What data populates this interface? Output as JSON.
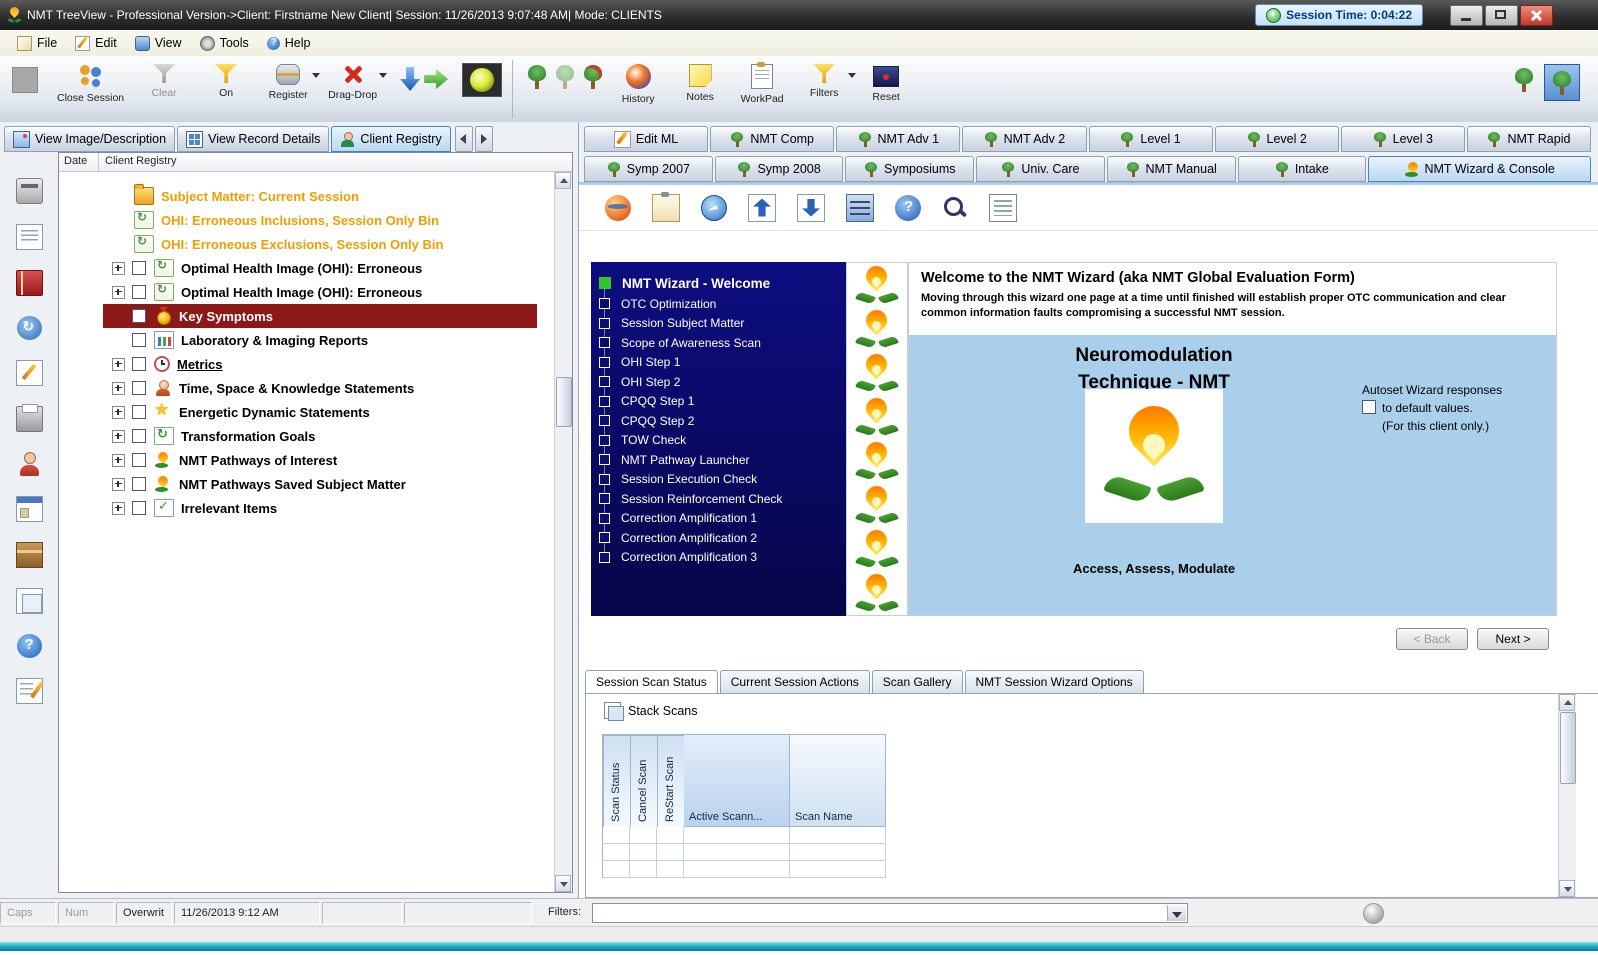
{
  "titlebar": {
    "title": "NMT TreeView - Professional Version->Client: Firstname New Client| Session: 11/26/2013 9:07:48 AM| Mode: CLIENTS",
    "session_time": "Session Time: 0:04:22"
  },
  "menubar": {
    "items": [
      {
        "label": "File",
        "icon": "file"
      },
      {
        "label": "Edit",
        "icon": "editpage"
      },
      {
        "label": "View",
        "icon": "view"
      },
      {
        "label": "Tools",
        "icon": "tools"
      },
      {
        "label": "Help",
        "icon": "helpmini"
      }
    ]
  },
  "toolbar": {
    "close_session": "Close Session",
    "clear": "Clear",
    "on": "On",
    "register": "Register",
    "drag_drop": "Drag-Drop",
    "history": "History",
    "notes": "Notes",
    "workpad": "WorkPad",
    "filters": "Filters",
    "reset": "Reset"
  },
  "left_tabs": {
    "items": [
      {
        "label": "View Image/Description",
        "icon": "image"
      },
      {
        "label": "View Record Details",
        "icon": "grid"
      },
      {
        "label": "Client Registry",
        "icon": "clientreg",
        "active": true
      }
    ]
  },
  "tree": {
    "columns": [
      "Date",
      "Client Registry"
    ],
    "items": [
      {
        "label": "Subject Matter: Current Session",
        "cls": "orange",
        "icon": "folderop"
      },
      {
        "label": "OHI: Erroneous Inclusions, Session Only Bin",
        "cls": "orange",
        "icon": "scroll"
      },
      {
        "label": "OHI: Erroneous Exclusions, Session Only Bin",
        "cls": "orange",
        "icon": "scroll"
      },
      {
        "label": "Optimal Health Image (OHI): Erroneous",
        "icon": "scroll",
        "expand": true,
        "check": true
      },
      {
        "label": "Optimal Health Image (OHI): Erroneous",
        "icon": "scroll",
        "expand": true,
        "check": true
      },
      {
        "label": "Key Symptoms",
        "cls": "selected",
        "icon": "trophy",
        "check": true
      },
      {
        "label": "Laboratory & Imaging Reports",
        "icon": "chart",
        "check": true
      },
      {
        "label": "Metrics",
        "cls": "underline",
        "icon": "clock",
        "expand": true,
        "check": true
      },
      {
        "label": "Time, Space & Knowledge Statements",
        "icon": "person",
        "expand": true,
        "check": true
      },
      {
        "label": "Energetic Dynamic Statements",
        "icon": "star",
        "expand": true,
        "check": true
      },
      {
        "label": "Transformation Goals",
        "icon": "recycle",
        "expand": true,
        "check": true
      },
      {
        "label": "NMT Pathways of Interest",
        "icon": "flame",
        "expand": true,
        "check": true
      },
      {
        "label": "NMT Pathways Saved Subject Matter",
        "icon": "flame",
        "expand": true,
        "check": true
      },
      {
        "label": "Irrelevant Items",
        "icon": "pagecheck",
        "expand": true,
        "check": true
      }
    ]
  },
  "right_tabs": {
    "row1": [
      {
        "label": "Edit ML",
        "icon": "pencil"
      },
      {
        "label": "NMT Comp",
        "icon": "tree"
      },
      {
        "label": "NMT Adv 1",
        "icon": "tree"
      },
      {
        "label": "NMT Adv 2",
        "icon": "tree"
      },
      {
        "label": "Level 1",
        "icon": "tree"
      },
      {
        "label": "Level 2",
        "icon": "tree"
      },
      {
        "label": "Level 3",
        "icon": "tree"
      },
      {
        "label": "NMT Rapid",
        "icon": "tree"
      }
    ],
    "row2": [
      {
        "label": "Symp 2007",
        "icon": "tree"
      },
      {
        "label": "Symp 2008",
        "icon": "tree"
      },
      {
        "label": "Symposiums",
        "icon": "tree"
      },
      {
        "label": "Univ. Care",
        "icon": "tree"
      },
      {
        "label": "NMT Manual",
        "icon": "tree"
      },
      {
        "label": "Intake",
        "icon": "tree"
      },
      {
        "label": "NMT Wizard & Console",
        "icon": "flame",
        "active": true
      }
    ]
  },
  "wizard": {
    "nav": [
      {
        "label": "NMT Wizard - Welcome",
        "current": true
      },
      {
        "label": "OTC Optimization"
      },
      {
        "label": "Session Subject Matter"
      },
      {
        "label": "Scope of Awareness Scan"
      },
      {
        "label": "OHI Step 1"
      },
      {
        "label": "OHI Step 2"
      },
      {
        "label": "CPQQ Step 1"
      },
      {
        "label": "CPQQ Step 2"
      },
      {
        "label": "TOW Check"
      },
      {
        "label": "NMT Pathway Launcher"
      },
      {
        "label": "Session Execution Check"
      },
      {
        "label": "Session Reinforcement Check"
      },
      {
        "label": "Correction Amplification 1"
      },
      {
        "label": "Correction Amplification 2"
      },
      {
        "label": "Correction Amplification 3"
      }
    ],
    "welcome_title": "Welcome to the NMT Wizard (aka NMT Global Evaluation Form)",
    "welcome_body": "Moving through this wizard one page at a time until finished will establish proper OTC communication and clear common information faults compromising a successful NMT session.",
    "brand_line1": "Neuromodulation",
    "brand_line2": "Technique - NMT",
    "autoset": {
      "line1": "Autoset Wizard responses",
      "line2": "to default values.",
      "line3": "(For this client only.)"
    },
    "tagline": "Access, Assess, Modulate",
    "back_label": "< Back",
    "next_label": "Next >"
  },
  "bottom_tabs": {
    "items": [
      {
        "label": "Session Scan Status",
        "active": true
      },
      {
        "label": "Current Session Actions"
      },
      {
        "label": "Scan Gallery"
      },
      {
        "label": "NMT Session Wizard Options"
      }
    ]
  },
  "scan_panel": {
    "title": "Stack Scans",
    "rotated_columns": [
      "Scan Status",
      "Cancel Scan",
      "ReStart Scan"
    ],
    "columns": [
      "Active Scann...",
      "Scan Name"
    ]
  },
  "statusbar": {
    "caps": "Caps",
    "num": "Num",
    "overwrite": "Overwrit",
    "datetime": "11/26/2013 9:12 AM",
    "filters_label": "Filters:"
  }
}
